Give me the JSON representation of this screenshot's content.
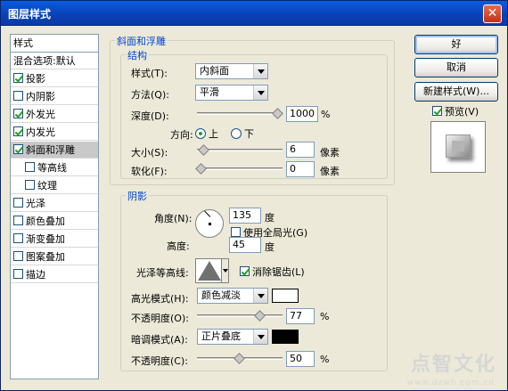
{
  "window": {
    "title": "图层样式",
    "close_glyph": "✕"
  },
  "style_list": {
    "header": "样式",
    "blend": "混合选项:默认",
    "items": [
      {
        "label": "投影",
        "checked": true
      },
      {
        "label": "内阴影",
        "checked": false
      },
      {
        "label": "外发光",
        "checked": true
      },
      {
        "label": "内发光",
        "checked": true
      },
      {
        "label": "斜面和浮雕",
        "checked": true
      },
      {
        "label": "等高线",
        "checked": false
      },
      {
        "label": "纹理",
        "checked": false
      },
      {
        "label": "光泽",
        "checked": false
      },
      {
        "label": "颜色叠加",
        "checked": false
      },
      {
        "label": "渐变叠加",
        "checked": false
      },
      {
        "label": "图案叠加",
        "checked": false
      },
      {
        "label": "描边",
        "checked": false
      }
    ]
  },
  "bevel": {
    "group_title": "斜面和浮雕",
    "structure_title": "结构",
    "style_label": "样式(T):",
    "style_value": "内斜面",
    "technique_label": "方法(Q):",
    "technique_value": "平滑",
    "depth_label": "深度(D):",
    "depth_value": "1000",
    "depth_level_pct": 100,
    "percent": "%",
    "direction_label": "方向:",
    "direction_up": "上",
    "direction_down": "下",
    "size_label": "大小(S):",
    "size_value": "6",
    "size_level_pct": 4,
    "soften_label": "软化(F):",
    "soften_value": "0",
    "soften_level_pct": 0,
    "pixels": "像素"
  },
  "shading": {
    "group_title": "阴影",
    "angle_label": "角度(N):",
    "angle_value": "135",
    "degree": "度",
    "global_light_label": "使用全局光(G)",
    "altitude_label": "高度:",
    "altitude_value": "45",
    "gloss_label": "光泽等高线:",
    "antialias_label": "消除锯齿(L)",
    "highlight_label": "高光模式(H):",
    "highlight_value": "颜色减淡",
    "highlight_color": "#ffffff",
    "hl_opacity_label": "不透明度(O):",
    "hl_opacity_value": "77",
    "hl_opacity_pct": 77,
    "shadow_label": "暗调模式(A):",
    "shadow_value": "正片叠底",
    "shadow_color": "#000000",
    "sh_opacity_label": "不透明度(C):",
    "sh_opacity_value": "50",
    "sh_opacity_pct": 50,
    "percent": "%"
  },
  "buttons": {
    "ok": "好",
    "cancel": "取消",
    "new_style": "新建样式(W)...",
    "preview": "预览(V)"
  },
  "watermark": {
    "text": "点智文化",
    "url": "www.dzwh.com.cn"
  }
}
